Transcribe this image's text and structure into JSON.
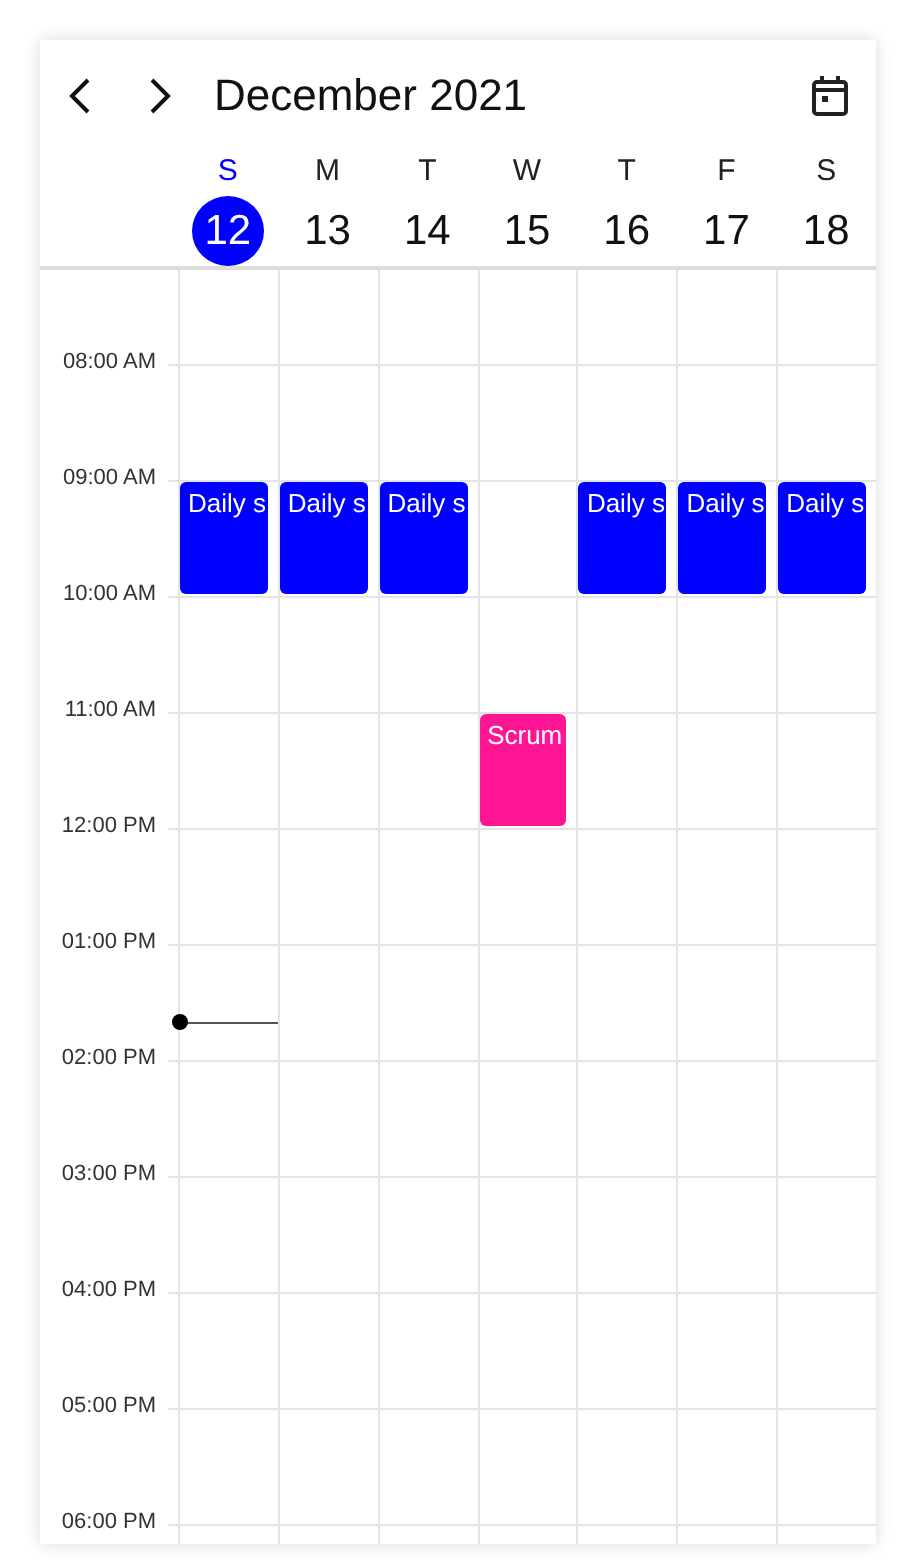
{
  "header": {
    "title": "December 2021"
  },
  "days": [
    {
      "letter": "S",
      "date": "12",
      "selected": true
    },
    {
      "letter": "M",
      "date": "13",
      "selected": false
    },
    {
      "letter": "T",
      "date": "14",
      "selected": false
    },
    {
      "letter": "W",
      "date": "15",
      "selected": false
    },
    {
      "letter": "T",
      "date": "16",
      "selected": false
    },
    {
      "letter": "F",
      "date": "17",
      "selected": false
    },
    {
      "letter": "S",
      "date": "18",
      "selected": false
    }
  ],
  "hours": [
    {
      "label": "08:00 AM"
    },
    {
      "label": "09:00 AM",
      "cells": [
        {
          "title": "Daily s",
          "color": "#0000ff"
        },
        {
          "title": "Daily s",
          "color": "#0000ff"
        },
        {
          "title": "Daily s",
          "color": "#0000ff"
        },
        null,
        {
          "title": "Daily s",
          "color": "#0000ff"
        },
        {
          "title": "Daily s",
          "color": "#0000ff"
        },
        {
          "title": "Daily s",
          "color": "#0000ff"
        }
      ]
    },
    {
      "label": "10:00 AM"
    },
    {
      "label": "11:00 AM",
      "cells": [
        null,
        null,
        null,
        {
          "title": "Scrum",
          "color": "#ff1493"
        },
        null,
        null,
        null
      ]
    },
    {
      "label": "12:00 PM"
    },
    {
      "label": "01:00 PM",
      "cells": [
        {
          "now": true
        },
        null,
        null,
        null,
        null,
        null,
        null
      ]
    },
    {
      "label": "02:00 PM"
    },
    {
      "label": "03:00 PM"
    },
    {
      "label": "04:00 PM"
    },
    {
      "label": "05:00 PM"
    },
    {
      "label": "06:00 PM"
    }
  ]
}
